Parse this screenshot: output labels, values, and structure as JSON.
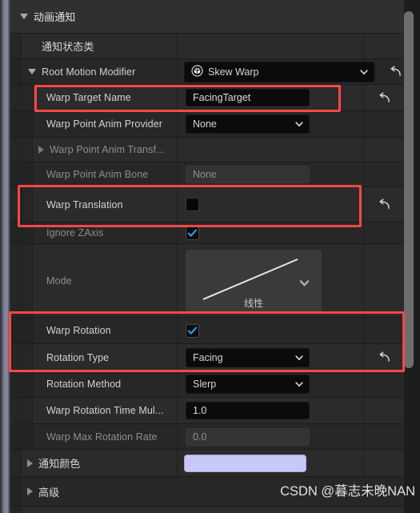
{
  "panel": {
    "title": "动画通知",
    "category_expanded": true
  },
  "icons": {
    "collapse_down": "triangle-down-icon",
    "collapse_right": "triangle-right-icon",
    "dropdown": "chevron-down-icon",
    "reset": "reset-arrow-icon",
    "class_picker": "cube-in-circle-icon",
    "check": "checkmark-icon"
  },
  "rows": [
    {
      "id": "notify-state-class",
      "label": "通知状态类",
      "label_cn": true,
      "widget": "none",
      "dim": false,
      "indent": 1,
      "reset": false
    },
    {
      "id": "root-motion-modifier",
      "label": "Root Motion Modifier",
      "widget": "combo-class",
      "value": "Skew Warp",
      "dim": false,
      "indent": 1,
      "expander": "down",
      "reset": true
    },
    {
      "id": "warp-target-name",
      "label": "Warp Target Name",
      "widget": "text",
      "value": "FacingTarget",
      "dim": false,
      "indent": 2,
      "reset": true,
      "highlight": true
    },
    {
      "id": "warp-point-anim-provider",
      "label": "Warp Point Anim Provider",
      "widget": "combo",
      "value": "None",
      "dim": false,
      "indent": 2,
      "reset": false
    },
    {
      "id": "warp-point-anim-transform",
      "label": "Warp Point Anim Transf...",
      "widget": "none",
      "dim": true,
      "indent": 2,
      "expander": "right",
      "reset": false
    },
    {
      "id": "warp-point-anim-bone",
      "label": "Warp Point Anim Bone",
      "widget": "text-disabled",
      "value": "None",
      "dim": true,
      "indent": 2,
      "reset": false
    },
    {
      "id": "warp-translation",
      "label": "Warp Translation",
      "widget": "swatch-black",
      "value": "",
      "dim": false,
      "indent": 2,
      "reset": true,
      "highlight": true
    },
    {
      "id": "ignore-zaxis",
      "label": "Ignore ZAxis",
      "widget": "checkbox",
      "value": "checked",
      "dim": true,
      "indent": 2,
      "reset": false
    },
    {
      "id": "mode",
      "label": "Mode",
      "widget": "curve",
      "value": "线性",
      "dim": true,
      "indent": 2,
      "reset": false
    },
    {
      "id": "warp-rotation",
      "label": "Warp Rotation",
      "widget": "checkbox",
      "value": "checked",
      "dim": false,
      "indent": 2,
      "reset": false,
      "highlight": true
    },
    {
      "id": "rotation-type",
      "label": "Rotation Type",
      "widget": "combo",
      "value": "Facing",
      "dim": false,
      "indent": 2,
      "reset": true,
      "highlight": true
    },
    {
      "id": "rotation-method",
      "label": "Rotation Method",
      "widget": "combo",
      "value": "Slerp",
      "dim": false,
      "indent": 2,
      "reset": false
    },
    {
      "id": "warp-rotation-time-multiplier",
      "label": "Warp Rotation Time Mul...",
      "widget": "text",
      "value": "1.0",
      "dim": false,
      "indent": 2,
      "reset": false
    },
    {
      "id": "warp-max-rotation-rate",
      "label": "Warp Max Rotation Rate",
      "widget": "text-disabled",
      "value": "0.0",
      "dim": true,
      "indent": 2,
      "reset": false
    },
    {
      "id": "notify-color",
      "label": "通知颜色",
      "label_cn": true,
      "widget": "swatch-color",
      "value": "#c8c8f8",
      "dim": false,
      "indent": 1,
      "expander": "right",
      "reset": false
    },
    {
      "id": "advanced",
      "label": "高级",
      "label_cn": true,
      "widget": "none",
      "dim": false,
      "indent": 1,
      "expander": "right",
      "reset": false
    }
  ],
  "colors": {
    "accent_checkbox": "#2f93e0",
    "notify_color_swatch": "#c8c8f8",
    "annotation": "#fc4747",
    "panel_bg": "#242424",
    "row_bg": "#2b2b2b",
    "category_bg": "#303030"
  },
  "watermark": {
    "text": "CSDN @暮志未晚NAN"
  },
  "scrollbar": {
    "orientation": "vertical",
    "thumb_position_pct": 2,
    "thumb_size_pct": 70
  }
}
